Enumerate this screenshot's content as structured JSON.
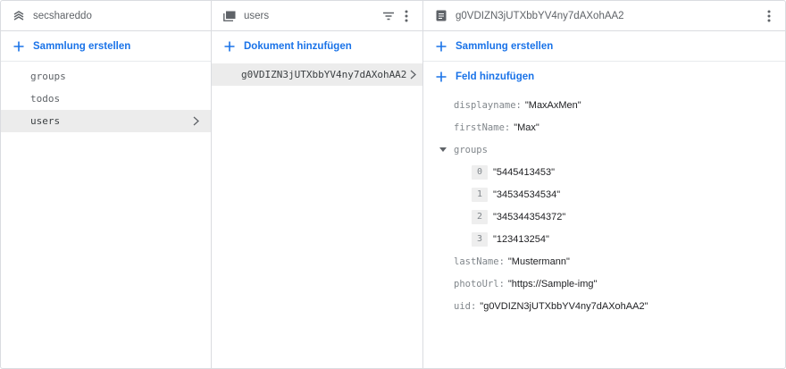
{
  "col1": {
    "header": {
      "title": "secshareddo",
      "icon": "firebase-project-icon"
    },
    "action": {
      "label": "Sammlung erstellen"
    },
    "collections": [
      {
        "label": "groups",
        "selected": false
      },
      {
        "label": "todos",
        "selected": false
      },
      {
        "label": "users",
        "selected": true
      }
    ]
  },
  "col2": {
    "header": {
      "title": "users",
      "icon": "collection-icon"
    },
    "action": {
      "label": "Dokument hinzufügen"
    },
    "documents": [
      {
        "label": "g0VDIZN3jUTXbbYV4ny7dAXohAA2",
        "selected": true
      }
    ]
  },
  "col3": {
    "header": {
      "title": "g0VDIZN3jUTXbbYV4ny7dAXohAA2",
      "icon": "document-icon"
    },
    "action_collection": {
      "label": "Sammlung erstellen"
    },
    "action_field": {
      "label": "Feld hinzufügen"
    },
    "fields": {
      "displayname": {
        "key": "displayname",
        "value": "\"MaxAxMen\""
      },
      "firstName": {
        "key": "firstName",
        "value": "\"Max\""
      },
      "groups": {
        "key": "groups",
        "items": [
          {
            "index": "0",
            "value": "\"5445413453\""
          },
          {
            "index": "1",
            "value": "\"34534534534\""
          },
          {
            "index": "2",
            "value": "\"345344354372\""
          },
          {
            "index": "3",
            "value": "\"123413254\""
          }
        ]
      },
      "lastName": {
        "key": "lastName",
        "value": "\"Mustermann\""
      },
      "photoUrl": {
        "key": "photoUrl",
        "value": "\"https://Sample-img\""
      },
      "uid": {
        "key": "uid",
        "value": "\"g0VDIZN3jUTXbbYV4ny7dAXohAA2\""
      }
    },
    "separator": ":"
  },
  "colors": {
    "accent": "#1a73e8",
    "border": "#dadce0",
    "selected_bg": "#ececec"
  }
}
